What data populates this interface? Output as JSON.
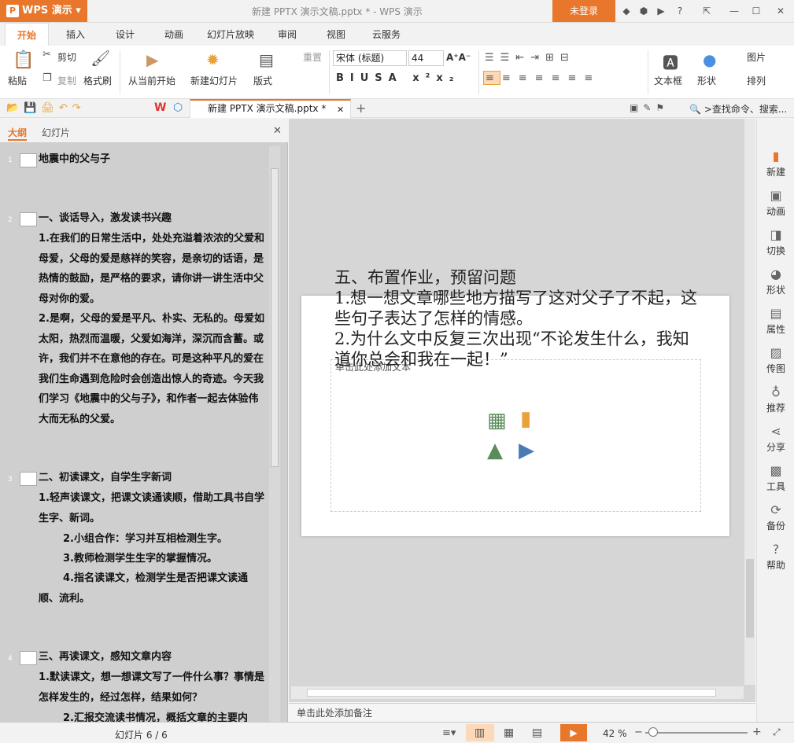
{
  "app": {
    "name": "WPS 演示",
    "doc_title": "新建 PPTX 演示文稿.pptx * - WPS 演示",
    "login_label": "未登录"
  },
  "tabs": [
    "开始",
    "插入",
    "设计",
    "动画",
    "幻灯片放映",
    "审阅",
    "视图",
    "云服务"
  ],
  "ribbon": {
    "paste": "粘贴",
    "cut": "剪切",
    "copy": "复制",
    "format_painter": "格式刷",
    "from_current": "从当前开始",
    "new_slide": "新建幻灯片",
    "layout": "版式",
    "reset": "重置",
    "font_name": "宋体 (标题)",
    "font_size": "44",
    "textbox": "文本框",
    "shape": "形状",
    "picture": "图片",
    "arrange": "排列"
  },
  "quickbar": {
    "file_tab": "新建 PPTX 演示文稿.pptx *",
    "search_placeholder": ">查找命令、搜索..."
  },
  "left_panel": {
    "tab_outline": "大纲",
    "tab_slides": "幻灯片",
    "items": [
      {
        "num": "1",
        "title": "地震中的父与子",
        "paragraphs": []
      },
      {
        "num": "2",
        "title": "一、谈话导入，激发读书兴趣",
        "paragraphs": [
          "1.在我们的日常生活中，处处充溢着浓浓的父爱和母爱，父母的爱是慈祥的笑容，是亲切的话语，是热情的鼓励，是严格的要求，请你讲一讲生活中父母对你的爱。",
          "2.是啊，父母的爱是平凡、朴实、无私的。母爱如太阳，热烈而温暖，父爱如海洋，深沉而含蓄。或许，我们并不在意他的存在。可是这种平凡的爱在我们生命遇到危险时会创造出惊人的奇迹。今天我们学习《地震中的父与子》，和作者一起去体验伟大而无私的父爱。"
        ]
      },
      {
        "num": "3",
        "title": "二、初读课文，自学生字新词",
        "paragraphs": [
          "1.轻声读课文，把课文读通读顺，借助工具书自学生字、新词。",
          "2.小组合作：学习并互相检测生字。",
          "3.教师检测学生生字的掌握情况。",
          "4.指名读课文，检测学生是否把课文读通顺、流利。"
        ]
      },
      {
        "num": "4",
        "title": "三、再读课文，感知文章内容",
        "paragraphs": [
          "1.默读课文，想一想课文写了一件什么事？事情是怎样发生的，经过怎样，结果如何？",
          "2.汇报交流读书情况，概括文章的主要内"
        ]
      }
    ]
  },
  "slide": {
    "title": "五、布置作业，预留问题",
    "lines": [
      "1.想一想文章哪些地方描写了这对父子了不起，这些句子表达了怎样的情感。",
      "2.为什么文中反复三次出现“不论发生什么，我知道你总会和我在一起！”"
    ],
    "placeholder_label": "单击此处添加文本"
  },
  "notes_placeholder": "单击此处添加备注",
  "right_bar": [
    "新建",
    "动画",
    "切换",
    "形状",
    "属性",
    "传图",
    "推荐",
    "分享",
    "工具",
    "备份",
    "帮助"
  ],
  "status": {
    "slide_counter": "幻灯片 6 / 6",
    "zoom": "42 %"
  }
}
